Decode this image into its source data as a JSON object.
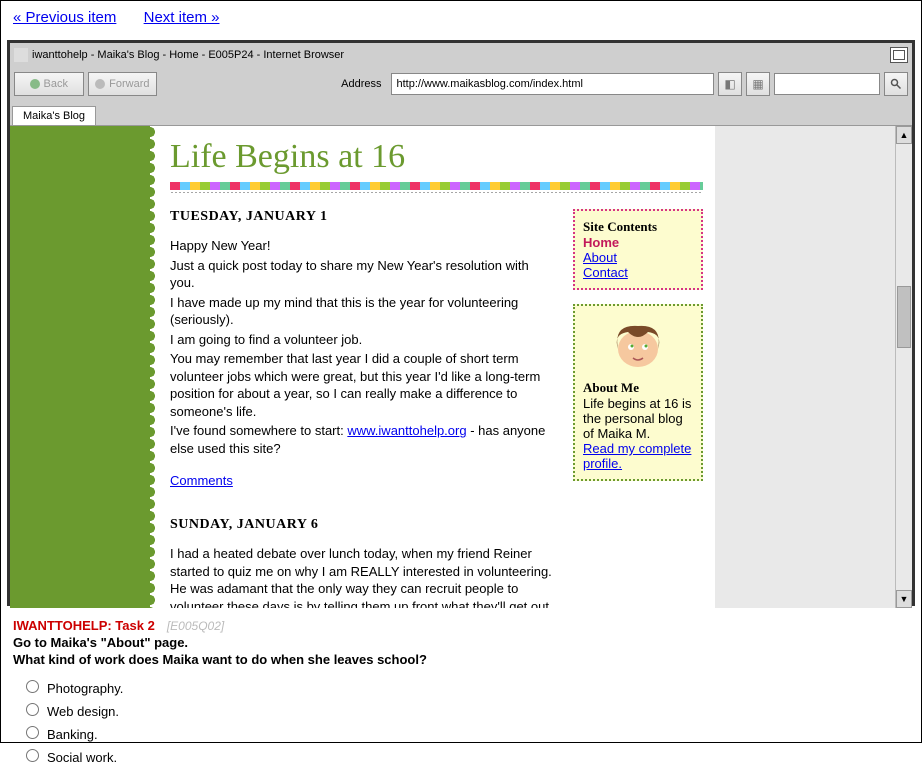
{
  "nav": {
    "prev": "« Previous item",
    "next": "Next item »"
  },
  "window": {
    "title": "iwanttohelp - Maika's Blog - Home - E005P24 - Internet Browser",
    "back": "Back",
    "forward": "Forward",
    "address_label": "Address",
    "address_value": "http://www.maikasblog.com/index.html",
    "tab": "Maika's Blog"
  },
  "blog": {
    "title": "Life Begins at 16",
    "post1": {
      "date": "TUESDAY, JANUARY 1",
      "l1": "Happy New Year!",
      "l2": "Just a quick post today to share my New Year's resolution with you.",
      "l3": "I have made up my mind that this is the year for volunteering (seriously).",
      "l4": "I am going to find a volunteer job.",
      "l5": "You may remember that last year I did a couple of short term volunteer jobs which were great, but this year I'd like a long-term position for about a year, so I can really make a difference to someone's life.",
      "l6a": "I've found somewhere to start: ",
      "link": "www.iwanttohelp.org",
      "l6b": " - has anyone else used this site?",
      "comments": "Comments"
    },
    "post2": {
      "date": "SUNDAY, JANUARY 6",
      "l1": "I had a heated debate over lunch today, when my friend Reiner started to quiz me on why I am REALLY interested in volunteering. He was adamant that the only way they can recruit people to volunteer these days is by telling them up front what they'll get out"
    },
    "side_contents": {
      "title": "Site Contents",
      "home": "Home",
      "about": "About",
      "contact": "Contact"
    },
    "about": {
      "title": "About Me",
      "text": "Life begins at 16 is the personal blog of Maika M.",
      "link": "Read my complete profile."
    }
  },
  "task": {
    "head": "IWANTTOHELP: Task 2",
    "code": "[E005Q02]",
    "line1": "Go to Maika's \"About\" page.",
    "line2": "What kind of work does Maika want to do when she leaves school?",
    "opts": [
      "Photography.",
      "Web design.",
      "Banking.",
      "Social work."
    ]
  }
}
